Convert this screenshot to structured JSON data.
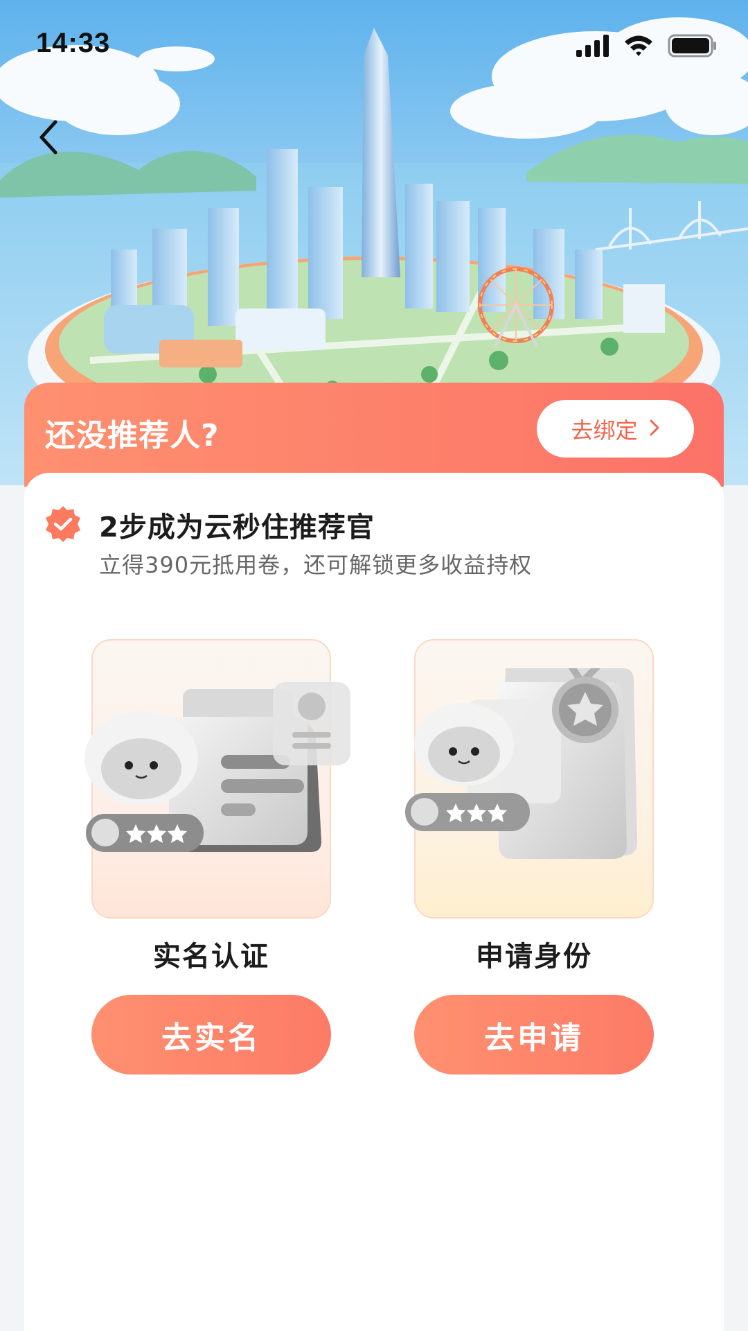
{
  "status_bar": {
    "time": "14:33",
    "icons": [
      "signal-icon",
      "wifi-icon",
      "battery-icon"
    ]
  },
  "nav": {
    "back_icon": "chevron-left-icon"
  },
  "referrer": {
    "title": "还没推荐人?",
    "bind_label": "去绑定",
    "bind_icon": "chevron-right-icon"
  },
  "intro": {
    "badge_icon": "verified-badge-icon",
    "title": "2步成为云秒住推荐官",
    "subtitle": "立得390元抵用卷，还可解锁更多收益持权"
  },
  "steps": [
    {
      "label": "实名认证",
      "button": "去实名",
      "illustration": "id-card-mascot-illustration"
    },
    {
      "label": "申请身份",
      "button": "去申请",
      "illustration": "medal-mascot-illustration"
    }
  ],
  "colors": {
    "accent": "#fd7f6a",
    "accent_light": "#fe9070",
    "bind_text": "#f4644a",
    "page_bg": "#f2f4f6"
  }
}
